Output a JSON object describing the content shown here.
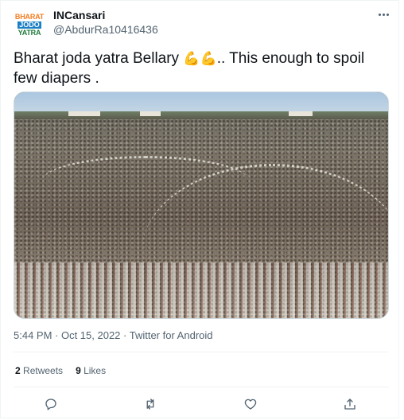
{
  "author": {
    "avatar_text": [
      "BHARAT",
      "JODO",
      "YATRA"
    ],
    "display_name": "INCansari",
    "handle": "@AbdurRa10416436"
  },
  "tweet": {
    "text_before": "Bharat joda yatra Bellary ",
    "emoji": "💪💪",
    "text_after": ".. This enough to spoil few diapers ."
  },
  "media": {
    "description_icon": "crowd-photo"
  },
  "meta": {
    "timestamp": "5:44 PM · Oct 15, 2022 · Twitter for Android"
  },
  "stats": {
    "retweets_count": "2",
    "retweets_label": "Retweets",
    "likes_count": "9",
    "likes_label": "Likes"
  },
  "actions": [
    "reply-icon",
    "retweet-icon",
    "like-icon",
    "share-icon"
  ],
  "colors": {
    "secondary_text": "#536471",
    "primary_text": "#0f1419",
    "border": "#eff3f4"
  }
}
